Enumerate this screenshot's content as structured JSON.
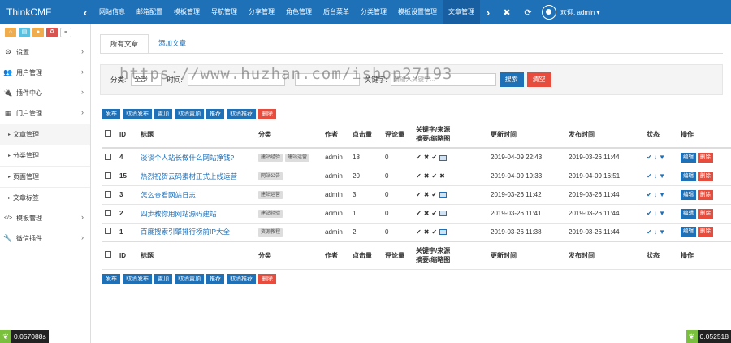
{
  "header": {
    "brand": "ThinkCMF",
    "left_arrow": "‹",
    "right_arrow": "›",
    "tabs": [
      "网站信息",
      "邮箱配置",
      "模板管理",
      "导航管理",
      "分享管理",
      "角色管理",
      "后台菜单",
      "分类管理",
      "模板设置管理",
      "文章管理"
    ],
    "icons": {
      "close": "✖",
      "refresh": "⟳"
    },
    "user_label": "欢迎, admin ▾"
  },
  "sidebar": {
    "items": [
      {
        "icon": "⚙",
        "label": "设置"
      },
      {
        "icon": "👥",
        "label": "用户管理"
      },
      {
        "icon": "🔌",
        "label": "插件中心"
      },
      {
        "icon": "▦",
        "label": "门户管理"
      }
    ],
    "subs": [
      "文章管理",
      "分类管理",
      "页面管理",
      "文章标签"
    ],
    "bottom": [
      {
        "icon": "</>",
        "label": "模板管理"
      },
      {
        "icon": "🔧",
        "label": "微信插件"
      }
    ]
  },
  "main": {
    "tab_all": "所有文章",
    "tab_add": "添加文章",
    "watermark": "https://www.huzhan.com/ishop27193",
    "filter": {
      "category_label": "分类:",
      "category_value": "全部",
      "time_label": "时间:",
      "keyword_label": "关键字:",
      "keyword_placeholder": "请输入关键字...",
      "search_btn": "搜索",
      "clear_btn": "清空"
    },
    "actions_top": [
      "发布",
      "取消发布",
      "置顶",
      "取消置顶",
      "推荐",
      "取消推荐",
      "删除"
    ],
    "actions_bottom": [
      "发布",
      "取消发布",
      "置顶",
      "取消置顶",
      "推荐",
      "取消推荐",
      "删除"
    ],
    "columns": {
      "id": "ID",
      "title": "标题",
      "cat": "分类",
      "author": "作者",
      "hits": "点击量",
      "comments": "评论量",
      "kw1": "关键字/来源",
      "kw2": "摘要/缩略图",
      "updated": "更新时间",
      "published": "发布时间",
      "status": "状态",
      "op": "操作"
    },
    "rows": [
      {
        "id": "4",
        "title": "淡谈个人站长做什么网站挣钱?",
        "tags": [
          "建站经验",
          "建站运营"
        ],
        "author": "admin",
        "hits": "18",
        "comments": "0",
        "flags": [
          "✔",
          "✖",
          "✔",
          "img"
        ],
        "updated": "2019-04-09 22:43",
        "published": "2019-03-26 11:44"
      },
      {
        "id": "15",
        "title": "热烈祝贺云码素材正式上线运营",
        "tags": [
          "网站公告"
        ],
        "author": "admin",
        "hits": "20",
        "comments": "0",
        "flags": [
          "✔",
          "✖",
          "✔",
          "✖"
        ],
        "updated": "2019-04-09 19:33",
        "published": "2019-04-09 16:51"
      },
      {
        "id": "3",
        "title": "怎么查看网站日志",
        "tags": [
          "建站运营"
        ],
        "author": "admin",
        "hits": "3",
        "comments": "0",
        "flags": [
          "✔",
          "✖",
          "✔",
          "img"
        ],
        "updated": "2019-03-26 11:42",
        "published": "2019-03-26 11:44"
      },
      {
        "id": "2",
        "title": "四步教你用网站源码建站",
        "tags": [
          "建站经验"
        ],
        "author": "admin",
        "hits": "1",
        "comments": "0",
        "flags": [
          "✔",
          "✖",
          "✔",
          "img"
        ],
        "updated": "2019-03-26 11:41",
        "published": "2019-03-26 11:44"
      },
      {
        "id": "1",
        "title": "百度搜索引擎排行榜前IP大全",
        "tags": [
          "资源教程"
        ],
        "author": "admin",
        "hits": "2",
        "comments": "0",
        "flags": [
          "✔",
          "✖",
          "✔",
          "img"
        ],
        "updated": "2019-03-26 11:38",
        "published": "2019-03-26 11:44"
      }
    ],
    "status_icons": "✔ ↓ ▼",
    "edit_label": "编辑",
    "delete_label": "删除"
  },
  "timers": {
    "left": "0.057088s",
    "right": "0.052518"
  }
}
